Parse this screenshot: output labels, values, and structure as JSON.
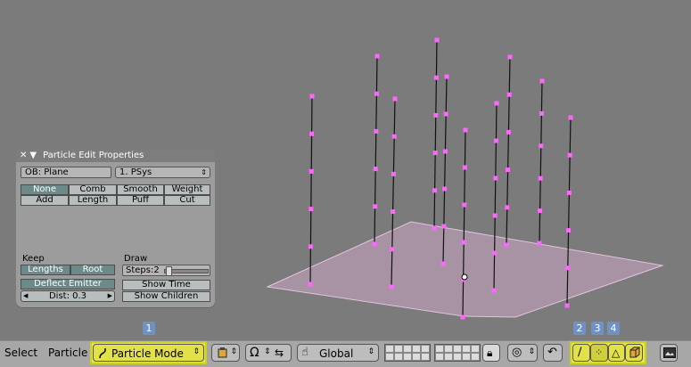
{
  "panel": {
    "title": "Particle Edit Properties",
    "object_field": "OB: Plane",
    "psys_menu": "1. PSys",
    "brushes_row1": [
      "None",
      "Comb",
      "Smooth",
      "Weight"
    ],
    "brushes_row2": [
      "Add",
      "Length",
      "Puff",
      "Cut"
    ],
    "keep_label": "Keep",
    "keep_buttons": [
      "Lengths",
      "Root"
    ],
    "deflect_button": "Deflect Emitter",
    "dist_field": "Dist: 0.3",
    "draw_label": "Draw",
    "steps_slider": "Steps:2",
    "show_time": "Show Time",
    "show_children": "Show Children"
  },
  "header": {
    "menu_select": "Select",
    "menu_particle": "Particle",
    "mode_menu": "Particle Mode",
    "orientation_menu": "Global",
    "badges": [
      "1",
      "2",
      "3",
      "4"
    ]
  },
  "colors": {
    "viewport_bg": "#7b7b7b",
    "particle_key": "#ff66ff",
    "plane_fill": "#a893a4",
    "highlight_yellow": "#e7e64b",
    "badge_blue": "#6f91c4"
  }
}
